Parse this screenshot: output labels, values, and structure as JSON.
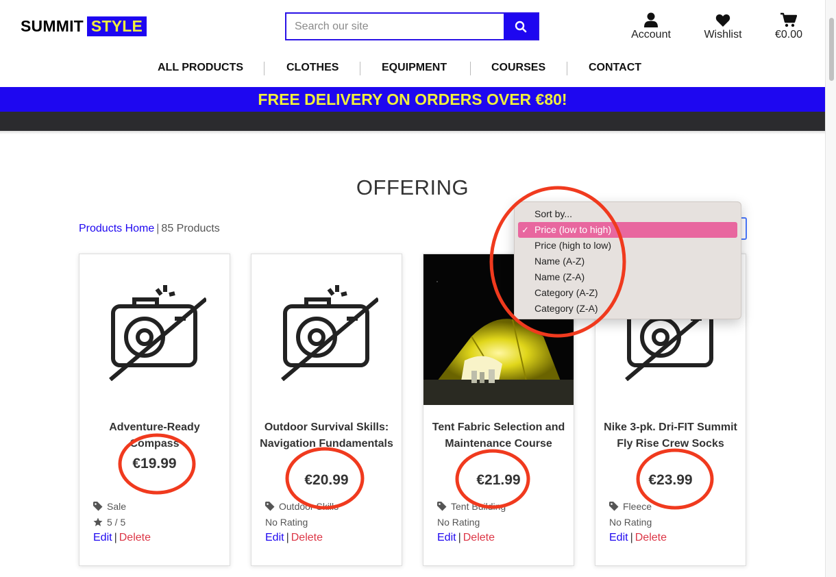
{
  "header": {
    "logo_part1": "SUMMIT",
    "logo_part2": "STYLE",
    "search_placeholder": "Search our site",
    "account_label": "Account",
    "wishlist_label": "Wishlist",
    "bag_total": "€0.00"
  },
  "nav": {
    "items": [
      "ALL PRODUCTS",
      "CLOTHES",
      "EQUIPMENT",
      "COURSES",
      "CONTACT"
    ]
  },
  "banner": {
    "text": "FREE DELIVERY ON ORDERS OVER €80!"
  },
  "main": {
    "title": "OFFERING",
    "breadcrumb_link": "Products Home",
    "breadcrumb_sep": "|",
    "product_count": "85 Products"
  },
  "sort": {
    "options": [
      "Sort by...",
      "Price (low to high)",
      "Price (high to low)",
      "Name (A-Z)",
      "Name (Z-A)",
      "Category (A-Z)",
      "Category (Z-A)"
    ],
    "selected_index": 1
  },
  "products": [
    {
      "name": "Adventure-Ready Compass",
      "price": "€19.99",
      "category": "Sale",
      "rating": "5 / 5",
      "edit": "Edit",
      "delete": "Delete",
      "sep": "|",
      "image": "no-image"
    },
    {
      "name": "Outdoor Survival Skills: Navigation Fundamentals",
      "price": "€20.99",
      "category": "Outdoor Skills",
      "rating": "No Rating",
      "edit": "Edit",
      "delete": "Delete",
      "sep": "|",
      "image": "no-image"
    },
    {
      "name": "Tent Fabric Selection and Maintenance Course",
      "price": "€21.99",
      "category": "Tent Building",
      "rating": "No Rating",
      "edit": "Edit",
      "delete": "Delete",
      "sep": "|",
      "image": "tent-photo"
    },
    {
      "name": "Nike 3-pk. Dri-FIT Summit Fly Rise Crew Socks",
      "price": "€23.99",
      "category": "Fleece",
      "rating": "No Rating",
      "edit": "Edit",
      "delete": "Delete",
      "sep": "|",
      "image": "no-image"
    }
  ],
  "colors": {
    "brand_blue": "#1e07f0",
    "brand_yellow": "#f0ef3c",
    "annotation_red": "#f03a1e",
    "selected_option": "#e8679f",
    "delete_red": "#dc3545"
  }
}
